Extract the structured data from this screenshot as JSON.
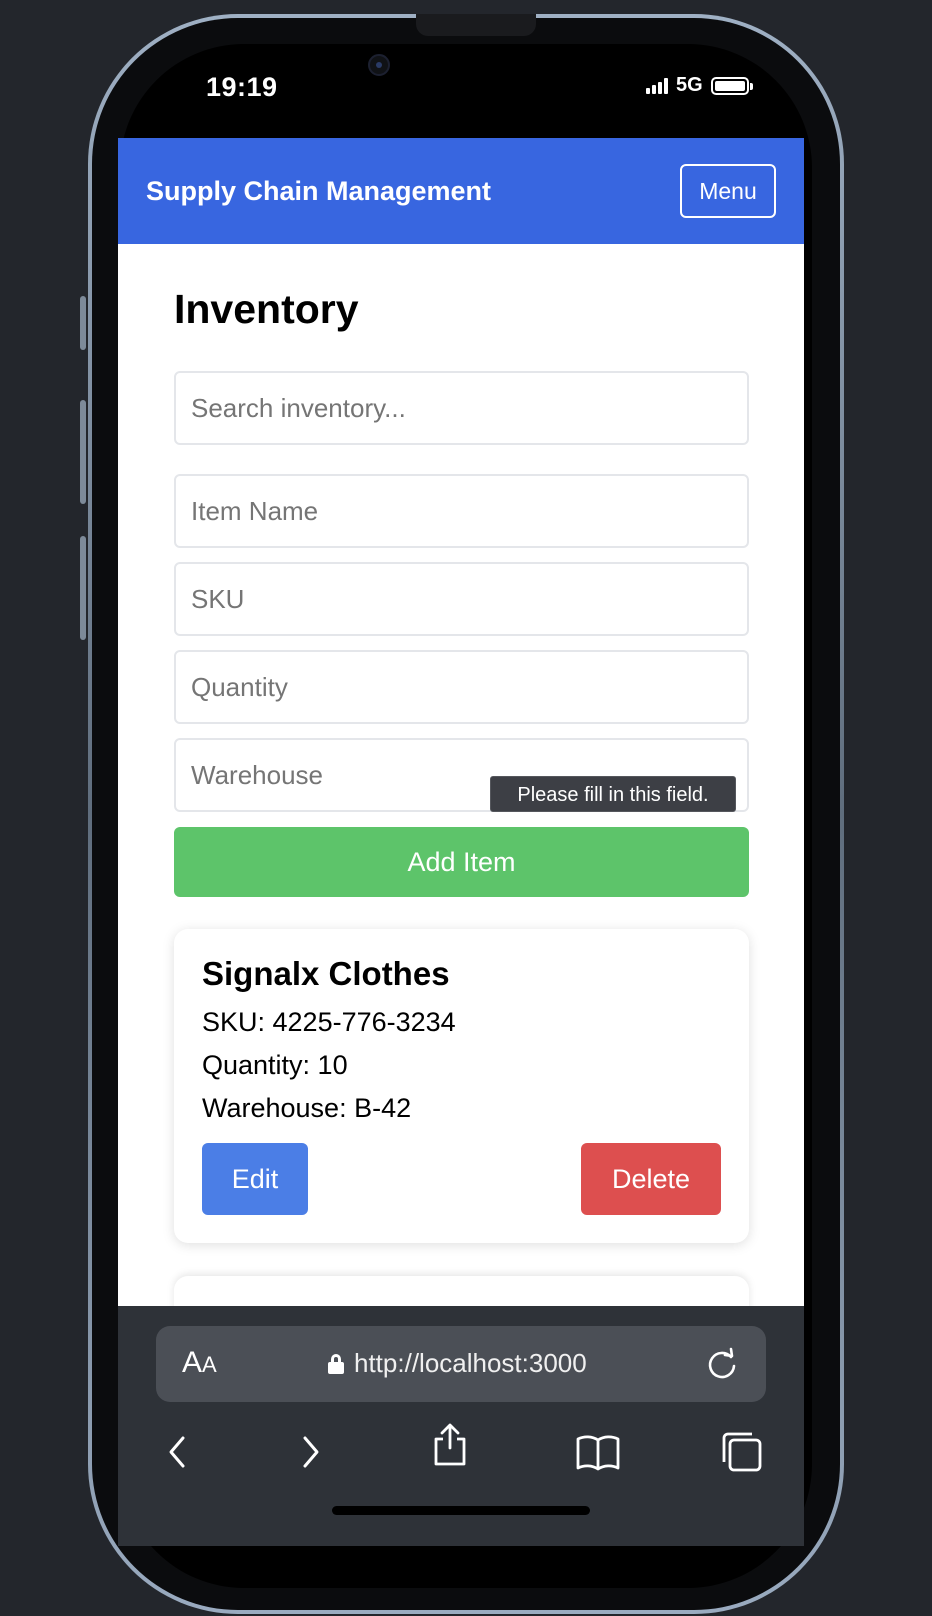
{
  "device": {
    "time": "19:19",
    "network": "5G"
  },
  "app": {
    "title": "Supply Chain Management",
    "menu_label": "Menu",
    "brand_color": "#3866e0"
  },
  "page": {
    "heading": "Inventory"
  },
  "form": {
    "search_placeholder": "Search inventory...",
    "item_name_placeholder": "Item Name",
    "sku_placeholder": "SKU",
    "quantity_placeholder": "Quantity",
    "warehouse_placeholder": "Warehouse",
    "validation_message": "Please fill in this field.",
    "add_label": "Add Item",
    "add_color": "#5dc46a"
  },
  "items": [
    {
      "name": "Signalx Clothes",
      "sku": "SKU: 4225-776-3234",
      "quantity": "Quantity: 10",
      "warehouse": "Warehouse: B-42",
      "edit_label": "Edit",
      "delete_label": "Delete"
    }
  ],
  "browser": {
    "text_size_large": "A",
    "text_size_small": "A",
    "url": "http://localhost:3000",
    "icons": [
      "lock-icon",
      "reload-icon",
      "back-icon",
      "forward-icon",
      "share-icon",
      "bookmarks-icon",
      "tabs-icon"
    ]
  }
}
